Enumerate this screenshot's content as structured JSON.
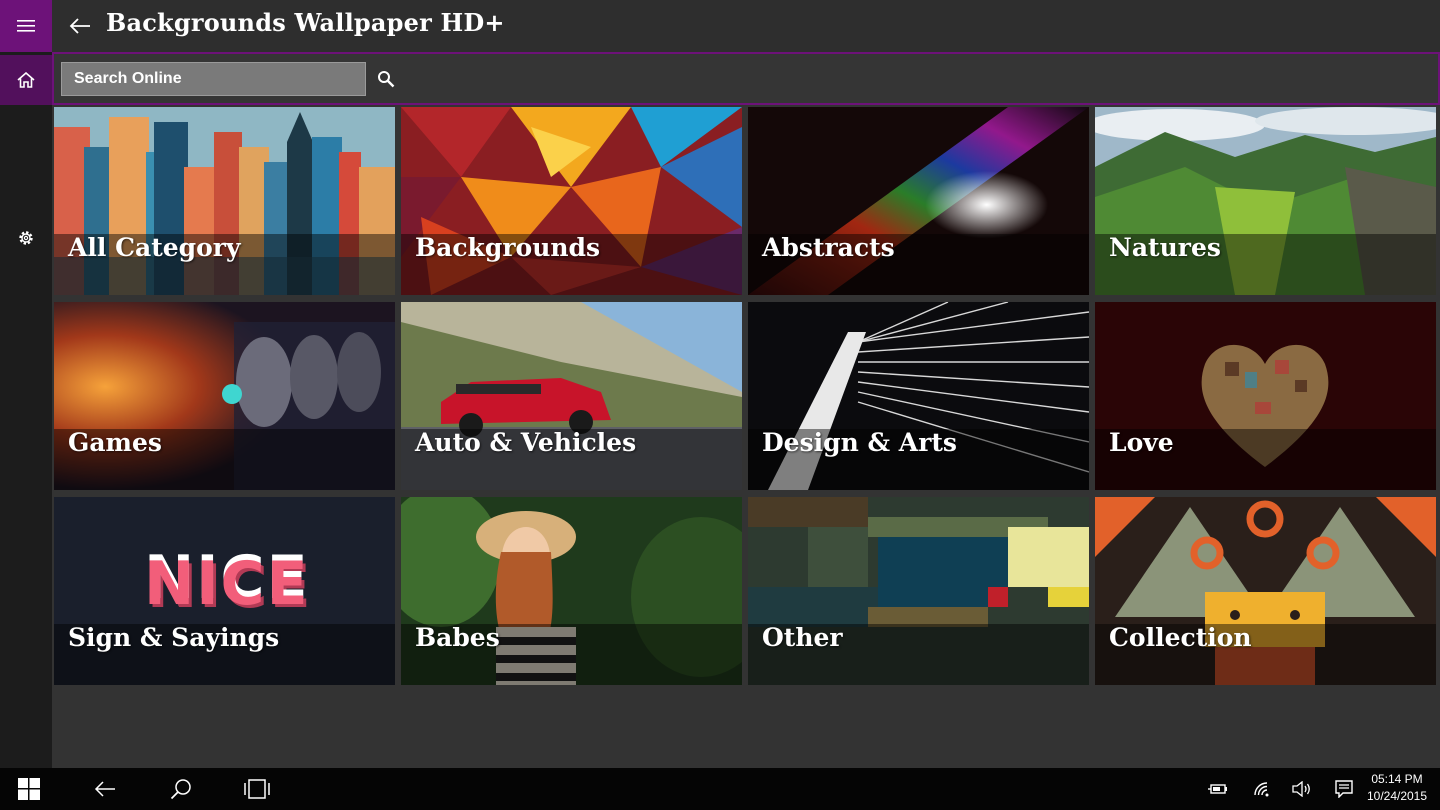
{
  "app": {
    "title": "Backgrounds Wallpaper HD+",
    "accent_color": "#6d1279"
  },
  "rail": {
    "menu_icon": "hamburger-icon",
    "home_icon": "home-icon",
    "settings_icon": "gear-icon"
  },
  "search": {
    "placeholder": "Search Online",
    "value": "",
    "icon": "search-icon"
  },
  "categories": [
    {
      "label": "All Category"
    },
    {
      "label": "Backgrounds"
    },
    {
      "label": "Abstracts"
    },
    {
      "label": "Natures"
    },
    {
      "label": "Games"
    },
    {
      "label": "Auto & Vehicles"
    },
    {
      "label": "Design & Arts"
    },
    {
      "label": "Love"
    },
    {
      "label": "Sign & Sayings",
      "art_text": "NICE"
    },
    {
      "label": "Babes"
    },
    {
      "label": "Other"
    },
    {
      "label": "Collection"
    }
  ],
  "taskbar": {
    "start_icon": "windows-logo-icon",
    "back_icon": "back-arrow-icon",
    "search_icon": "search-icon",
    "task_view_icon": "task-view-icon",
    "tray_icons": [
      "battery-icon",
      "wifi-icon",
      "volume-icon",
      "action-center-icon"
    ],
    "time": "05:14 PM",
    "date": "10/24/2015"
  }
}
